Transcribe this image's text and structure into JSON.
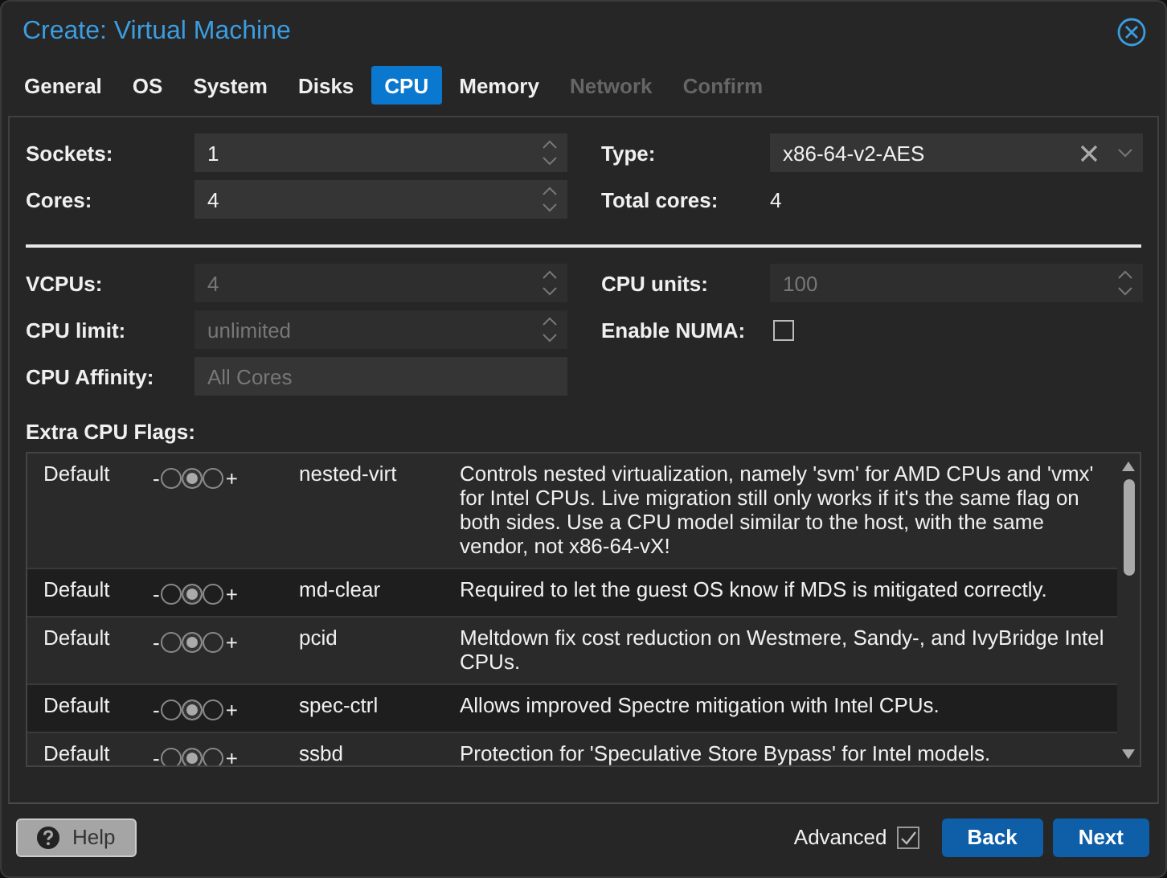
{
  "window": {
    "title": "Create: Virtual Machine"
  },
  "tabs": [
    {
      "label": "General",
      "selected": false,
      "disabled": false
    },
    {
      "label": "OS",
      "selected": false,
      "disabled": false
    },
    {
      "label": "System",
      "selected": false,
      "disabled": false
    },
    {
      "label": "Disks",
      "selected": false,
      "disabled": false
    },
    {
      "label": "CPU",
      "selected": true,
      "disabled": false
    },
    {
      "label": "Memory",
      "selected": false,
      "disabled": false
    },
    {
      "label": "Network",
      "selected": false,
      "disabled": true
    },
    {
      "label": "Confirm",
      "selected": false,
      "disabled": true
    }
  ],
  "basic_fields": [
    {
      "label": "Sockets:",
      "kind": "spinner",
      "value": "1"
    },
    {
      "label": "Type:",
      "kind": "combo",
      "value": "x86-64-v2-AES"
    },
    {
      "label": "Cores:",
      "kind": "spinner",
      "value": "4"
    },
    {
      "label": "Total cores:",
      "kind": "display",
      "value": "4"
    }
  ],
  "advanced_fields": [
    {
      "label": "VCPUs:",
      "kind": "spinner",
      "value": "4",
      "disabled": true
    },
    {
      "label": "CPU units:",
      "kind": "spinner",
      "value": "100",
      "disabled": true
    },
    {
      "label": "CPU limit:",
      "kind": "spinner",
      "value": "unlimited",
      "disabled": true
    },
    {
      "label": "Enable NUMA:",
      "kind": "checkbox",
      "checked": false
    },
    {
      "label": "CPU Affinity:",
      "kind": "text",
      "placeholder": "All Cores"
    }
  ],
  "flags_label": "Extra CPU Flags:",
  "flags": [
    {
      "state_text": "Default",
      "minus": "-",
      "plus": "+",
      "options": [
        {
          "selected": false
        },
        {
          "selected": true
        },
        {
          "selected": false
        }
      ],
      "name": "nested-virt",
      "description": "Controls nested virtualization, namely 'svm' for AMD CPUs and 'vmx' for Intel CPUs. Live migration still only works if it's the same flag on both sides. Use a CPU model similar to the host, with the same vendor, not x86-64-vX!"
    },
    {
      "state_text": "Default",
      "minus": "-",
      "plus": "+",
      "options": [
        {
          "selected": false
        },
        {
          "selected": true
        },
        {
          "selected": false
        }
      ],
      "name": "md-clear",
      "description": "Required to let the guest OS know if MDS is mitigated correctly."
    },
    {
      "state_text": "Default",
      "minus": "-",
      "plus": "+",
      "options": [
        {
          "selected": false
        },
        {
          "selected": true
        },
        {
          "selected": false
        }
      ],
      "name": "pcid",
      "description": "Meltdown fix cost reduction on Westmere, Sandy-, and IvyBridge Intel CPUs."
    },
    {
      "state_text": "Default",
      "minus": "-",
      "plus": "+",
      "options": [
        {
          "selected": false
        },
        {
          "selected": true
        },
        {
          "selected": false
        }
      ],
      "name": "spec-ctrl",
      "description": "Allows improved Spectre mitigation with Intel CPUs."
    },
    {
      "state_text": "Default",
      "minus": "-",
      "plus": "+",
      "options": [
        {
          "selected": false
        },
        {
          "selected": true
        },
        {
          "selected": false
        }
      ],
      "name": "ssbd",
      "description": "Protection for 'Speculative Store Bypass' for Intel models."
    }
  ],
  "footer": {
    "help": "Help",
    "advanced": {
      "label": "Advanced",
      "checked": true
    },
    "buttons": [
      "Back",
      "Next"
    ]
  }
}
